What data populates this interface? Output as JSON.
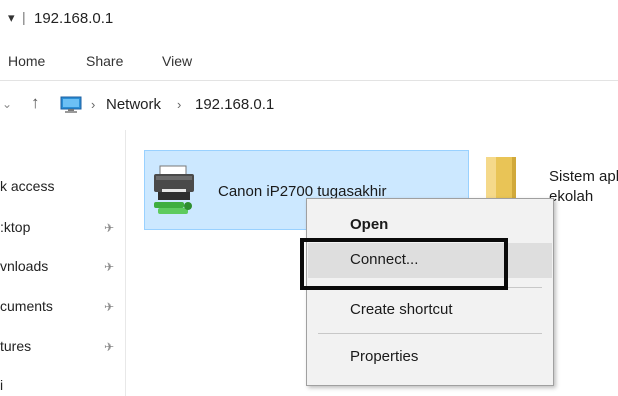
{
  "window": {
    "title": "192.168.0.1",
    "title_separator": "|",
    "quick_access_glyph": "▾"
  },
  "ribbon": {
    "tabs": [
      {
        "label": "Home"
      },
      {
        "label": "Share"
      },
      {
        "label": "View"
      }
    ]
  },
  "address_bar": {
    "back_glyph": "⌄",
    "up_glyph": "↑",
    "separator": "›",
    "breadcrumbs": [
      "Network",
      "192.168.0.1"
    ],
    "location_icon": "computer-icon"
  },
  "nav_pane": {
    "items": [
      {
        "label": "k access",
        "pinned": false
      },
      {
        "label": ":ktop",
        "pinned": true
      },
      {
        "label": "vnloads",
        "pinned": true
      },
      {
        "label": "cuments",
        "pinned": true
      },
      {
        "label": "tures",
        "pinned": true
      },
      {
        "label": "i",
        "pinned": false
      }
    ],
    "pin_glyph": "✈"
  },
  "content": {
    "printer": {
      "label": "Canon iP2700 tugasakhir",
      "icon": "printer-icon",
      "selected": true
    },
    "folder": {
      "label_line1": "Sistem apl",
      "label_line2": "ekolah",
      "icon": "folder-icon"
    }
  },
  "context_menu": {
    "items": [
      {
        "label": "Open",
        "bold": true
      },
      {
        "label": "Connect...",
        "hovered": true
      },
      {
        "label": "Create shortcut"
      },
      {
        "label": "Properties"
      }
    ]
  },
  "colors": {
    "selection_fill": "#cce8ff",
    "selection_border": "#99d1ff",
    "menu_background": "#f2f2f2",
    "highlight_box": "#0a0a0a"
  }
}
